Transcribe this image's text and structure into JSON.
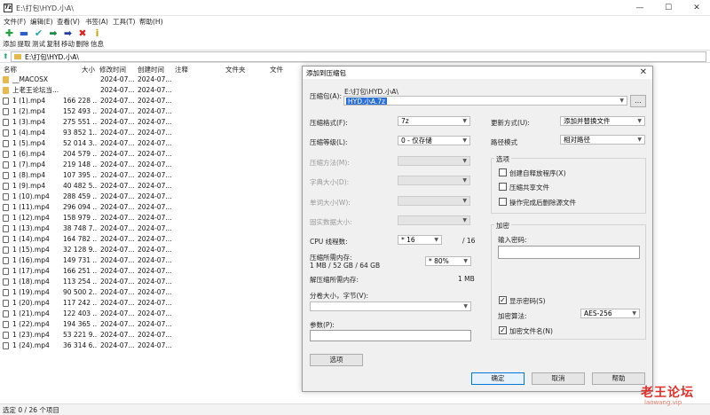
{
  "window": {
    "title": "E:\\打包\\HYD.小A\\",
    "app_icon": "7z",
    "minimize": "—",
    "maximize": "☐",
    "close": "✕"
  },
  "menu": [
    "文件(F)",
    "编辑(E)",
    "查看(V)",
    "书签(A)",
    "工具(T)",
    "帮助(H)"
  ],
  "toolbar": [
    {
      "label": "添加",
      "icon": "add-icon",
      "glyph": "✚",
      "color": "#1aa33a"
    },
    {
      "label": "提取",
      "icon": "extract-icon",
      "glyph": "▬",
      "color": "#2c5fc9"
    },
    {
      "label": "测试",
      "icon": "test-icon",
      "glyph": "✔",
      "color": "#2ca3a3"
    },
    {
      "label": "复制",
      "icon": "copy-icon",
      "glyph": "➡",
      "color": "#1e8a4a"
    },
    {
      "label": "移动",
      "icon": "move-icon",
      "glyph": "➡",
      "color": "#223f9a"
    },
    {
      "label": "删除",
      "icon": "delete-icon",
      "glyph": "✖",
      "color": "#d22"
    },
    {
      "label": "信息",
      "icon": "info-icon",
      "glyph": "i",
      "color": "#c8a200"
    }
  ],
  "address": {
    "path": "E:\\打包\\HYD.小A\\"
  },
  "columns": [
    "名称",
    "大小",
    "修改时间",
    "创建时间",
    "注释",
    "文件夹",
    "文件"
  ],
  "files": [
    {
      "type": "folder",
      "name": "__MACOSX",
      "size": "",
      "modified": "2024-07...",
      "created": "2024-07..."
    },
    {
      "type": "folder",
      "name": "上老王论坛当...",
      "size": "",
      "modified": "2024-07...",
      "created": "2024-07..."
    },
    {
      "type": "file",
      "name": "1 (1).mp4",
      "size": "166 228 ...",
      "modified": "2024-07...",
      "created": "2024-07..."
    },
    {
      "type": "file",
      "name": "1 (2).mp4",
      "size": "152 493 ...",
      "modified": "2024-07...",
      "created": "2024-07..."
    },
    {
      "type": "file",
      "name": "1 (3).mp4",
      "size": "275 551 ...",
      "modified": "2024-07...",
      "created": "2024-07..."
    },
    {
      "type": "file",
      "name": "1 (4).mp4",
      "size": "93 852 1...",
      "modified": "2024-07...",
      "created": "2024-07..."
    },
    {
      "type": "file",
      "name": "1 (5).mp4",
      "size": "52 014 3...",
      "modified": "2024-07...",
      "created": "2024-07..."
    },
    {
      "type": "file",
      "name": "1 (6).mp4",
      "size": "204 579 ...",
      "modified": "2024-07...",
      "created": "2024-07..."
    },
    {
      "type": "file",
      "name": "1 (7).mp4",
      "size": "219 148 ...",
      "modified": "2024-07...",
      "created": "2024-07..."
    },
    {
      "type": "file",
      "name": "1 (8).mp4",
      "size": "107 395 ...",
      "modified": "2024-07...",
      "created": "2024-07..."
    },
    {
      "type": "file",
      "name": "1 (9).mp4",
      "size": "40 482 5...",
      "modified": "2024-07...",
      "created": "2024-07..."
    },
    {
      "type": "file",
      "name": "1 (10).mp4",
      "size": "288 459 ...",
      "modified": "2024-07...",
      "created": "2024-07..."
    },
    {
      "type": "file",
      "name": "1 (11).mp4",
      "size": "296 094 ...",
      "modified": "2024-07...",
      "created": "2024-07..."
    },
    {
      "type": "file",
      "name": "1 (12).mp4",
      "size": "158 979 ...",
      "modified": "2024-07...",
      "created": "2024-07..."
    },
    {
      "type": "file",
      "name": "1 (13).mp4",
      "size": "38 748 7...",
      "modified": "2024-07...",
      "created": "2024-07..."
    },
    {
      "type": "file",
      "name": "1 (14).mp4",
      "size": "164 782 ...",
      "modified": "2024-07...",
      "created": "2024-07..."
    },
    {
      "type": "file",
      "name": "1 (15).mp4",
      "size": "32 128 9...",
      "modified": "2024-07...",
      "created": "2024-07..."
    },
    {
      "type": "file",
      "name": "1 (16).mp4",
      "size": "149 731 ...",
      "modified": "2024-07...",
      "created": "2024-07..."
    },
    {
      "type": "file",
      "name": "1 (17).mp4",
      "size": "166 251 ...",
      "modified": "2024-07...",
      "created": "2024-07..."
    },
    {
      "type": "file",
      "name": "1 (18).mp4",
      "size": "113 254 ...",
      "modified": "2024-07...",
      "created": "2024-07..."
    },
    {
      "type": "file",
      "name": "1 (19).mp4",
      "size": "90 500 2...",
      "modified": "2024-07...",
      "created": "2024-07..."
    },
    {
      "type": "file",
      "name": "1 (20).mp4",
      "size": "117 242 ...",
      "modified": "2024-07...",
      "created": "2024-07..."
    },
    {
      "type": "file",
      "name": "1 (21).mp4",
      "size": "122 403 ...",
      "modified": "2024-07...",
      "created": "2024-07..."
    },
    {
      "type": "file",
      "name": "1 (22).mp4",
      "size": "194 365 ...",
      "modified": "2024-07...",
      "created": "2024-07..."
    },
    {
      "type": "file",
      "name": "1 (23).mp4",
      "size": "53 221 9...",
      "modified": "2024-07...",
      "created": "2024-07..."
    },
    {
      "type": "file",
      "name": "1 (24).mp4",
      "size": "36 314 6...",
      "modified": "2024-07...",
      "created": "2024-07..."
    }
  ],
  "status": "选定 0 / 26 个项目",
  "dialog": {
    "title": "添加到压缩包",
    "close": "✕",
    "archive_label": "压缩包(A):",
    "archive_dir": "E:\\打包\\HYD.小A\\",
    "archive_name": "HYD.小A.7z",
    "browse": "...",
    "format_label": "压缩格式(F):",
    "format_value": "7z",
    "level_label": "压缩等级(L):",
    "level_value": "0 - 仅存储",
    "method_label": "压缩方法(M):",
    "dict_label": "字典大小(D):",
    "word_label": "单词大小(W):",
    "solid_label": "固实数据大小:",
    "threads_label": "CPU 线程数:",
    "threads_value": "* 16",
    "threads_max": "/ 16",
    "mem_label": "压缩所需内存:",
    "mem_value": "1 MB / 52 GB / 64 GB",
    "mem_pct": "* 80%",
    "demem_label": "解压缩所需内存:",
    "demem_value": "1 MB",
    "split_label": "分卷大小，字节(V):",
    "params_label": "参数(P):",
    "options_btn": "选项",
    "update_label": "更新方式(U):",
    "update_value": "添加并替换文件",
    "path_label": "路径模式",
    "path_value": "相对路径",
    "options_group": "选项",
    "opt_sfx": "创建自释放程序(X)",
    "opt_shared": "压缩共享文件",
    "opt_delete": "操作完成后删除源文件",
    "enc_group": "加密",
    "pwd_label": "输入密码:",
    "show_pwd": "显示密码(S)",
    "enc_method_label": "加密算法:",
    "enc_method_value": "AES-256",
    "enc_names": "加密文件名(N)",
    "ok": "确定",
    "cancel": "取消",
    "help": "帮助"
  },
  "watermark": {
    "title": "老王论坛",
    "url": "laowang.vip"
  }
}
